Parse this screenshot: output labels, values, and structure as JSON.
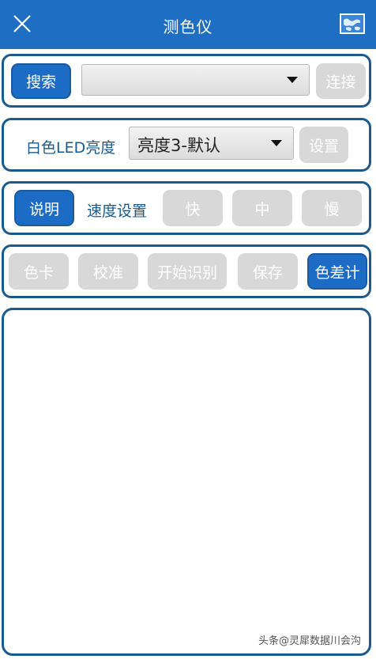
{
  "header": {
    "title": "测色仪",
    "close_icon": "close-icon",
    "map_icon": "map-icon",
    "background": "#1e6fc4"
  },
  "connect_row": {
    "search_label": "搜索",
    "device_select_value": "",
    "connect_label": "连接"
  },
  "brightness_row": {
    "label": "白色LED亮度",
    "select_value": "亮度3-默认",
    "set_label": "设置"
  },
  "speed_row": {
    "help_label": "说明",
    "speed_label": "速度设置",
    "fast_label": "快",
    "medium_label": "中",
    "slow_label": "慢"
  },
  "action_row": {
    "color_card_label": "色卡",
    "calibrate_label": "校准",
    "start_label": "开始识别",
    "save_label": "保存",
    "color_diff_label": "色差计"
  },
  "watermark": "头条@灵犀数据川会沟",
  "colors": {
    "accent": "#1c6cc6",
    "border": "#1a5a8e",
    "disabled": "#d8d8d8"
  }
}
